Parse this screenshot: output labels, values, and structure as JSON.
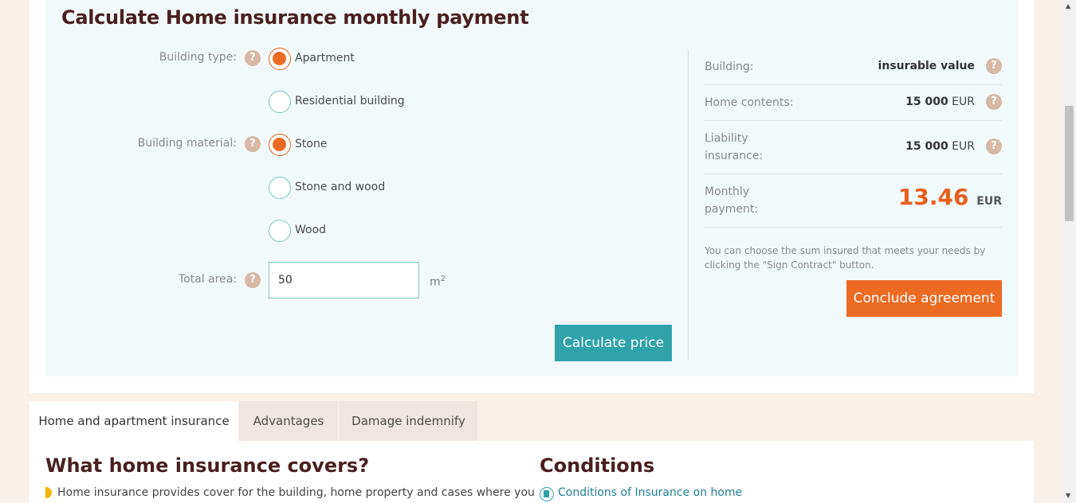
{
  "calculator": {
    "title": "Calculate Home insurance monthly payment",
    "building_type": {
      "label": "Building type:",
      "options": [
        "Apartment",
        "Residential building"
      ],
      "selected": "Apartment"
    },
    "building_material": {
      "label": "Building material:",
      "options": [
        "Stone",
        "Stone and wood",
        "Wood"
      ],
      "selected": "Stone"
    },
    "total_area": {
      "label": "Total area:",
      "value": "50",
      "unit": "m",
      "unit_sup": "2"
    },
    "calculate_button": "Calculate price"
  },
  "summary": {
    "building": {
      "label": "Building:",
      "value": "insurable value"
    },
    "home_contents": {
      "label": "Home contents:",
      "amount": "15 000",
      "currency": "EUR"
    },
    "liability": {
      "label_line1": "Liability",
      "label_line2": "insurance:",
      "amount": "15 000",
      "currency": "EUR"
    },
    "monthly": {
      "label_line1": "Monthly",
      "label_line2": "payment:",
      "amount": "13.46",
      "currency": "EUR"
    },
    "note": "You can choose the sum insured that meets your needs by clicking the \"Sign Contract\" button.",
    "conclude_button": "Conclude agreement"
  },
  "help_icon": "?",
  "tabs": [
    {
      "label": "Home and apartment insurance",
      "active": true
    },
    {
      "label": "Advantages",
      "active": false
    },
    {
      "label": "Damage indemnify",
      "active": false
    }
  ],
  "content": {
    "left_heading": "What home insurance covers?",
    "left_text": "Home insurance provides cover for the building, home property and cases where you",
    "right_heading": "Conditions",
    "right_link": "Conditions of Insurance on home"
  },
  "colors": {
    "accent": "#ec6b22",
    "teal": "#2fa3a9",
    "heading": "#4a1f1f"
  }
}
